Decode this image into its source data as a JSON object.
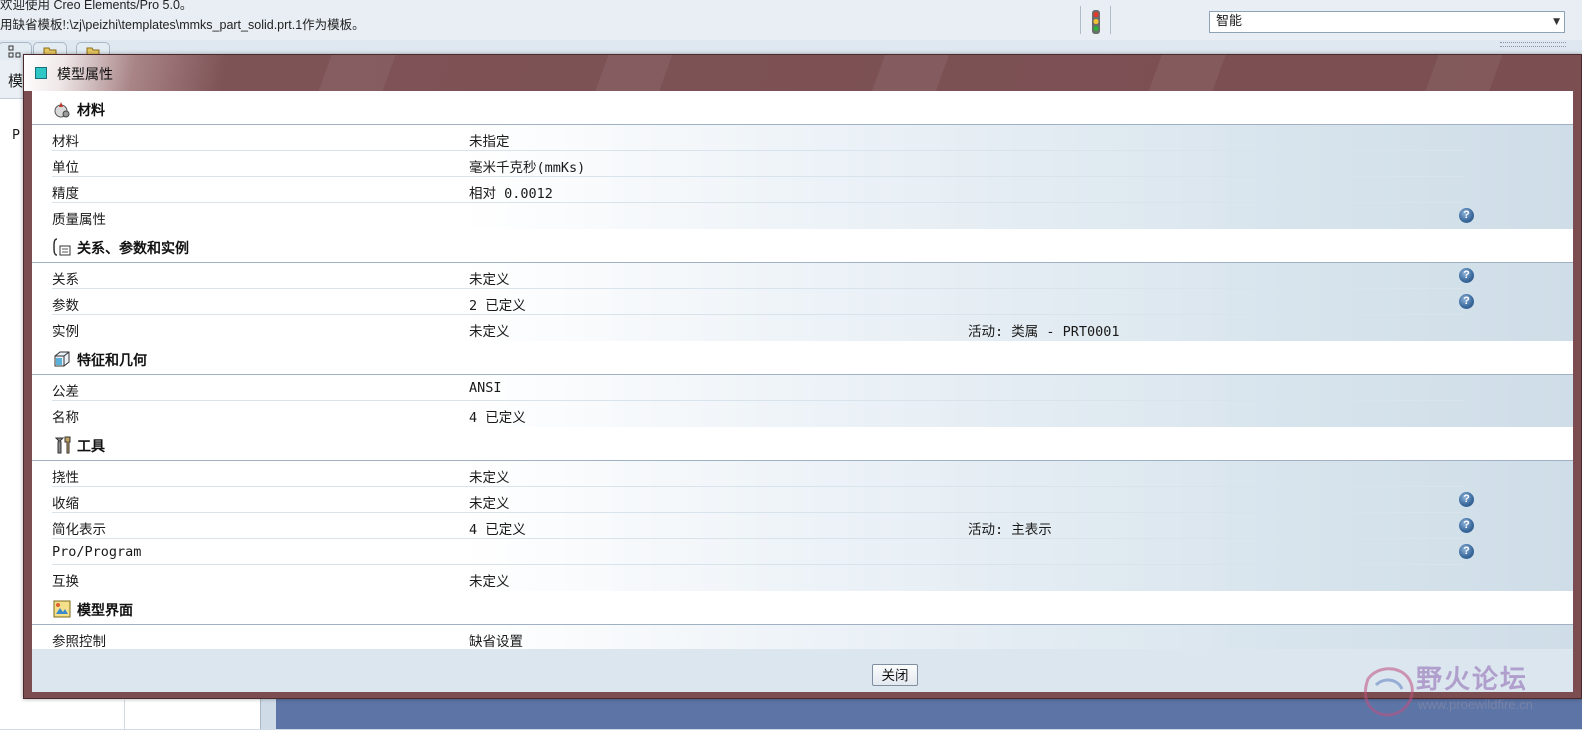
{
  "app": {
    "message_line1": "欢迎使用 Creo Elements/Pro 5.0。",
    "message_line2": "用缺省模板!:\\zj\\peizhi\\templates\\mmks_part_solid.prt.1作为模板。",
    "filter_select": "智能",
    "left_panel_header": "模",
    "tree_root": "P"
  },
  "dialog": {
    "title": "模型属性",
    "close_label": "关闭",
    "sections": [
      {
        "title": "材料",
        "icon": "material-icon",
        "rows": [
          {
            "label": "材料",
            "value": "未指定",
            "active": "",
            "help": false
          },
          {
            "label": "单位",
            "value": "毫米千克秒(mmKs)",
            "active": "",
            "help": false
          },
          {
            "label": "精度",
            "value": "相对 0.0012",
            "active": "",
            "help": false
          },
          {
            "label": "质量属性",
            "value": "",
            "active": "",
            "help": true
          }
        ]
      },
      {
        "title": "关系、参数和实例",
        "icon": "relations-icon",
        "rows": [
          {
            "label": "关系",
            "value": "未定义",
            "active": "",
            "help": true
          },
          {
            "label": "参数",
            "value": "2 已定义",
            "active": "",
            "help": true
          },
          {
            "label": "实例",
            "value": "未定义",
            "active": "活动: 类属 - PRT0001",
            "help": false
          }
        ]
      },
      {
        "title": "特征和几何",
        "icon": "feature-geometry-icon",
        "rows": [
          {
            "label": "公差",
            "value": "ANSI",
            "active": "",
            "help": false
          },
          {
            "label": "名称",
            "value": "4 已定义",
            "active": "",
            "help": false
          }
        ]
      },
      {
        "title": "工具",
        "icon": "tools-icon",
        "rows": [
          {
            "label": "挠性",
            "value": "未定义",
            "active": "",
            "help": false
          },
          {
            "label": "收缩",
            "value": "未定义",
            "active": "",
            "help": true
          },
          {
            "label": "简化表示",
            "value": "4 已定义",
            "active": "活动: 主表示",
            "help": true
          },
          {
            "label": "Pro/Program",
            "value": "",
            "active": "",
            "help": true
          },
          {
            "label": "互换",
            "value": "未定义",
            "active": "",
            "help": false
          }
        ]
      },
      {
        "title": "模型界面",
        "icon": "model-interface-icon",
        "rows": [
          {
            "label": "参照控制",
            "value": "缺省设置",
            "active": "",
            "help": false
          }
        ]
      }
    ]
  },
  "watermark": {
    "text": "野火论坛",
    "url": "www.proewildfire.cn"
  },
  "colors": {
    "title_bar": "#7b4d50",
    "help_icon": "#3d6c9f",
    "section_rule": "#9fb1c2"
  }
}
